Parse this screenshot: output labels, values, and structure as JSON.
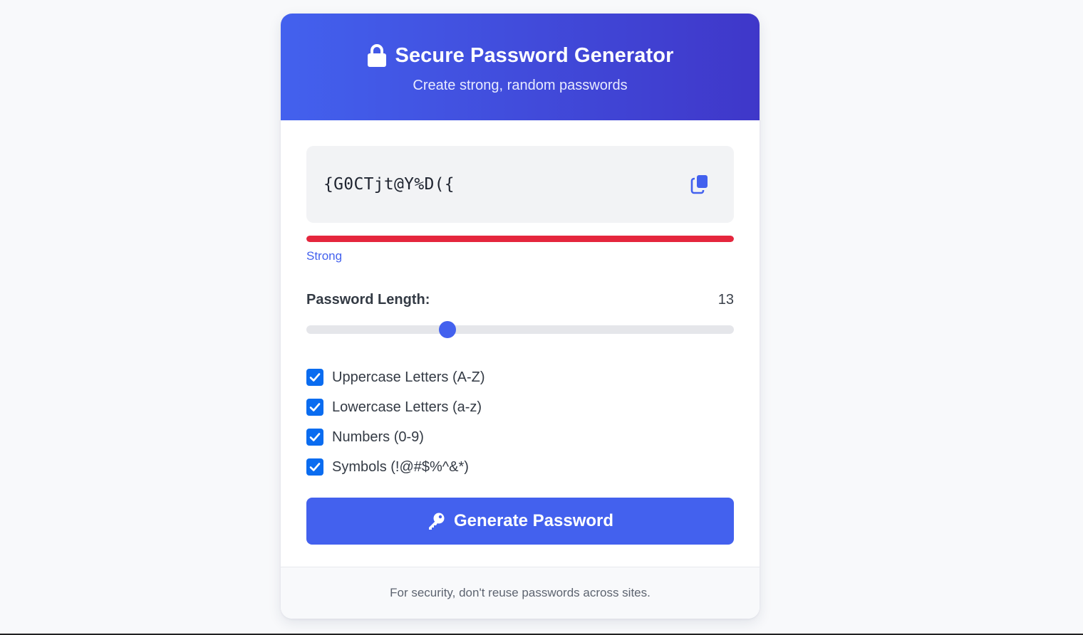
{
  "header": {
    "title": "Secure Password Generator",
    "subtitle": "Create strong, random passwords",
    "icon": "lock-icon"
  },
  "password": {
    "value": "{G0CTjt@Y%D({",
    "copy_icon": "copy-icon"
  },
  "strength": {
    "label": "Strong",
    "level": 1.0,
    "color": "#e5263d"
  },
  "length": {
    "label": "Password Length:",
    "value": "13",
    "slider_fraction": 0.33
  },
  "options": [
    {
      "label": "Uppercase Letters (A-Z)",
      "checked": true
    },
    {
      "label": "Lowercase Letters (a-z)",
      "checked": true
    },
    {
      "label": "Numbers (0-9)",
      "checked": true
    },
    {
      "label": "Symbols (!@#$%^&*)",
      "checked": true
    }
  ],
  "generate_button": {
    "label": "Generate Password",
    "icon": "key-icon"
  },
  "footer": {
    "text": "For security, don't reuse passwords across sites."
  },
  "colors": {
    "accent": "#4361ee",
    "accent_dark": "#3f37c9",
    "checkbox": "#0a6cf0"
  }
}
